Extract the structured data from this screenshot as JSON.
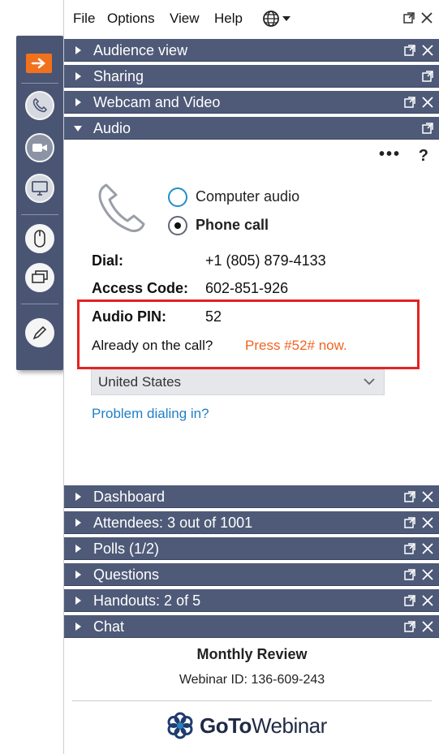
{
  "menu": {
    "file": "File",
    "options": "Options",
    "view": "View",
    "help": "Help"
  },
  "panels_top": [
    {
      "label": "Audience view"
    },
    {
      "label": "Sharing"
    },
    {
      "label": "Webcam and Video"
    },
    {
      "label": "Audio"
    }
  ],
  "audio": {
    "more": "•••",
    "help": "?",
    "options": [
      {
        "label": "Computer audio",
        "selected": false
      },
      {
        "label": "Phone call",
        "selected": true
      }
    ],
    "dial_label": "Dial:",
    "dial_value": "+1 (805) 879-4133",
    "access_label": "Access Code:",
    "access_value": "602-851-926",
    "pin_label": "Audio PIN:",
    "pin_value": "52",
    "already_text": "Already on the call?",
    "press_text": "Press #52# now.",
    "country": "United States",
    "problem_link": "Problem dialing in?"
  },
  "panels_bottom": [
    {
      "label": "Dashboard"
    },
    {
      "label": "Attendees: 3 out of 1001"
    },
    {
      "label": "Polls (1/2)"
    },
    {
      "label": "Questions"
    },
    {
      "label": "Handouts: 2 of 5"
    },
    {
      "label": "Chat"
    }
  ],
  "footer": {
    "title": "Monthly Review",
    "webinar_id": "Webinar ID: 136-609-243",
    "brand_goto": "GoTo",
    "brand_webinar": "Webinar"
  },
  "colors": {
    "header": "#4e5a78",
    "accent_orange": "#f2711c",
    "highlight_red": "#e32222",
    "link_blue": "#1f7fc8"
  }
}
